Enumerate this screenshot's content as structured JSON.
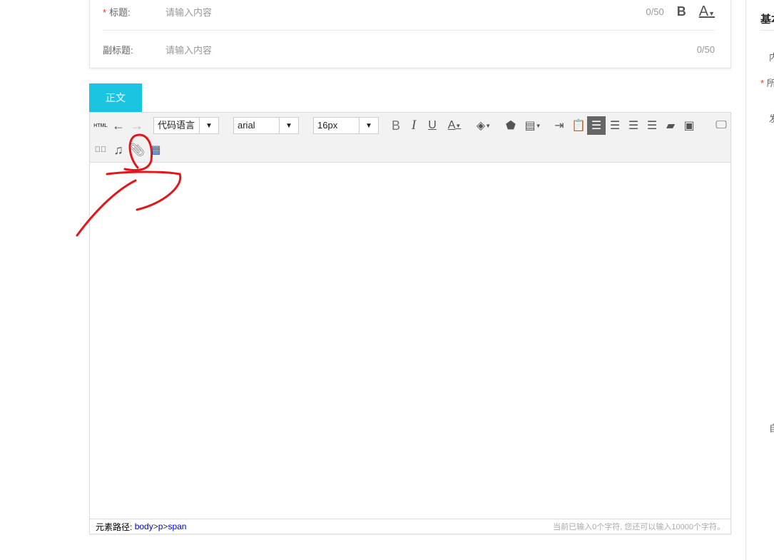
{
  "form": {
    "title_label": "标题:",
    "title_placeholder": "请输入内容",
    "title_count": "0/50",
    "subtitle_label": "副标题:",
    "subtitle_placeholder": "请输入内容",
    "subtitle_count": "0/50",
    "required_mark": "*",
    "bold": "B",
    "font_color": "A"
  },
  "tab": "正文",
  "toolbar": {
    "html": "HTML",
    "code_lang": "代码语言",
    "font": "arial",
    "size": "16px"
  },
  "status": {
    "path_label": "元素路径:",
    "path": [
      "body",
      "p",
      "span"
    ],
    "sep": " > ",
    "count": "当前已输入0个字符, 您还可以输入10000个字符。"
  },
  "side": {
    "heading": "基本",
    "items": [
      "内",
      "所",
      "发",
      "自"
    ]
  },
  "colors": {
    "accent": "#1bc4e0",
    "annotation": "#e0181b"
  }
}
